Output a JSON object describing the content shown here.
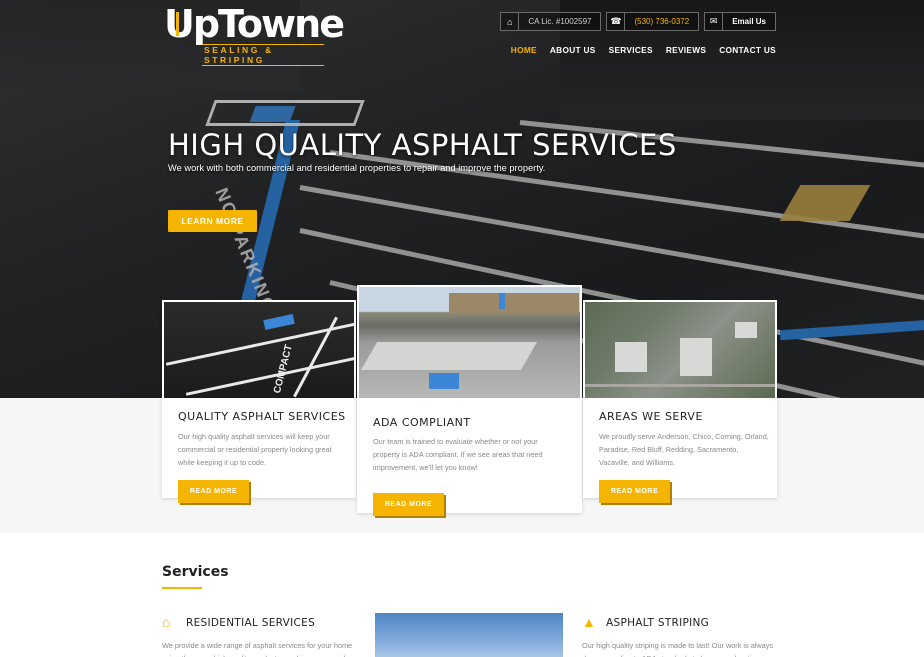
{
  "brand": {
    "logo_text": "UpTowne",
    "logo_tagline": "SEALING & STRIPING"
  },
  "topbar": {
    "license": "CA Lic. #1002597",
    "phone": "(530) 736-0372",
    "email_label": "Email Us"
  },
  "nav": {
    "items": [
      "HOME",
      "ABOUT US",
      "SERVICES",
      "REVIEWS",
      "CONTACT US"
    ],
    "active": "HOME"
  },
  "hero": {
    "title": "HIGH QUALITY ASPHALT SERVICES",
    "subtitle": "We work with both commercial and residential properties to repair and improve the property.",
    "button": "LEARN MORE",
    "paint_text": "NO PARKING"
  },
  "cards": [
    {
      "title": "QUALITY ASPHALT SERVICES",
      "text": "Our high quality asphalt services will keep your commercial or residential property looking great while keeping it up to code.",
      "button": "READ MORE"
    },
    {
      "title": "ADA COMPLIANT",
      "text": "Our team is trained to evaluate whether or not your property is ADA compliant. If we see areas that need improvement, we'll let you know!",
      "button": "READ MORE"
    },
    {
      "title": "AREAS WE SERVE",
      "text": "We proudly serve Anderson, Chico, Corning, Orland, Paradise, Red Bluff, Redding, Sacramento, Vacaville, and Williams.",
      "button": "READ MORE"
    }
  ],
  "photo_text": {
    "compact": "COMPACT"
  },
  "services": {
    "title": "Services",
    "residential": {
      "title": "RESIDENTIAL SERVICES",
      "text": "We provide a wide range of asphalt services for your home using the same high quality products used in commercial"
    },
    "striping": {
      "title": "ASPHALT STRIPING",
      "text": "Our high quality striping is made to last! Our work is always done according to ADA standards to keep your location"
    }
  },
  "colors": {
    "accent": "#f5b400",
    "blue_paint": "#2d7fd3"
  },
  "icons": {
    "home": "home-icon",
    "phone": "phone-icon",
    "email": "envelope-icon",
    "house": "house-icon",
    "road": "road-icon"
  }
}
